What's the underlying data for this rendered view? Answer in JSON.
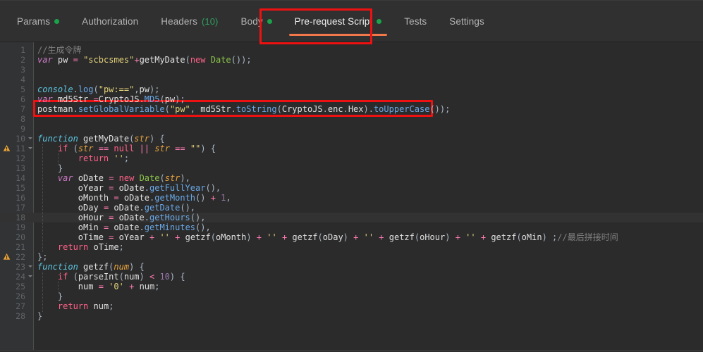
{
  "tabs": [
    {
      "label": "Params",
      "indicator": "green-dot",
      "count": null,
      "active": false
    },
    {
      "label": "Authorization",
      "indicator": null,
      "count": null,
      "active": false
    },
    {
      "label": "Headers",
      "indicator": null,
      "count": "(10)",
      "active": false
    },
    {
      "label": "Body",
      "indicator": "green-dot",
      "count": null,
      "active": false
    },
    {
      "label": "Pre-request Script",
      "indicator": "green-dot",
      "count": null,
      "active": true
    },
    {
      "label": "Tests",
      "indicator": null,
      "count": null,
      "active": false
    },
    {
      "label": "Settings",
      "indicator": null,
      "count": null,
      "active": false
    }
  ],
  "colors": {
    "accent_underline": "#f2784b",
    "indicator_green": "#1aa34a",
    "annotation_red": "#ee1111",
    "editor_background": "#2b2b2b",
    "gutter_background": "#313335",
    "warning_icon": "#e8a33d"
  },
  "annotations": [
    {
      "name": "tab-highlight",
      "target": "Pre-request Script"
    },
    {
      "name": "code-line-highlight",
      "target": "line 7"
    }
  ],
  "editor": {
    "language": "javascript",
    "total_lines": 28,
    "current_line": 18,
    "warning_lines": [
      11,
      22
    ],
    "fold_lines": [
      10,
      11,
      23,
      24
    ],
    "lines": [
      {
        "n": 1,
        "text": "//生成令牌"
      },
      {
        "n": 2,
        "text": "var pw = \"scbcsmes\"+getMyDate(new Date());"
      },
      {
        "n": 3,
        "text": ""
      },
      {
        "n": 4,
        "text": ""
      },
      {
        "n": 5,
        "text": "console.log(\"pw:==\",pw);"
      },
      {
        "n": 6,
        "text": "var md5Str =CryptoJS.MD5(pw);"
      },
      {
        "n": 7,
        "text": "postman.setGlobalVariable(\"pw\", md5Str.toString(CryptoJS.enc.Hex).toUpperCase());"
      },
      {
        "n": 8,
        "text": ""
      },
      {
        "n": 9,
        "text": ""
      },
      {
        "n": 10,
        "text": "function getMyDate(str) {"
      },
      {
        "n": 11,
        "text": "    if (str == null || str == \"\") {"
      },
      {
        "n": 12,
        "text": "        return '';"
      },
      {
        "n": 13,
        "text": "    }"
      },
      {
        "n": 14,
        "text": "    var oDate = new Date(str),"
      },
      {
        "n": 15,
        "text": "        oYear = oDate.getFullYear(),"
      },
      {
        "n": 16,
        "text": "        oMonth = oDate.getMonth() + 1,"
      },
      {
        "n": 17,
        "text": "        oDay = oDate.getDate(),"
      },
      {
        "n": 18,
        "text": "        oHour = oDate.getHours(),"
      },
      {
        "n": 19,
        "text": "        oMin = oDate.getMinutes(),"
      },
      {
        "n": 20,
        "text": "        oTime = oYear + '' + getzf(oMonth) + '' + getzf(oDay) + '' + getzf(oHour) + '' + getzf(oMin) ;//最后拼接时间"
      },
      {
        "n": 21,
        "text": "    return oTime;"
      },
      {
        "n": 22,
        "text": "};"
      },
      {
        "n": 23,
        "text": "function getzf(num) {"
      },
      {
        "n": 24,
        "text": "    if (parseInt(num) < 10) {"
      },
      {
        "n": 25,
        "text": "        num = '0' + num;"
      },
      {
        "n": 26,
        "text": "    }"
      },
      {
        "n": 27,
        "text": "    return num;"
      },
      {
        "n": 28,
        "text": "}"
      }
    ]
  }
}
